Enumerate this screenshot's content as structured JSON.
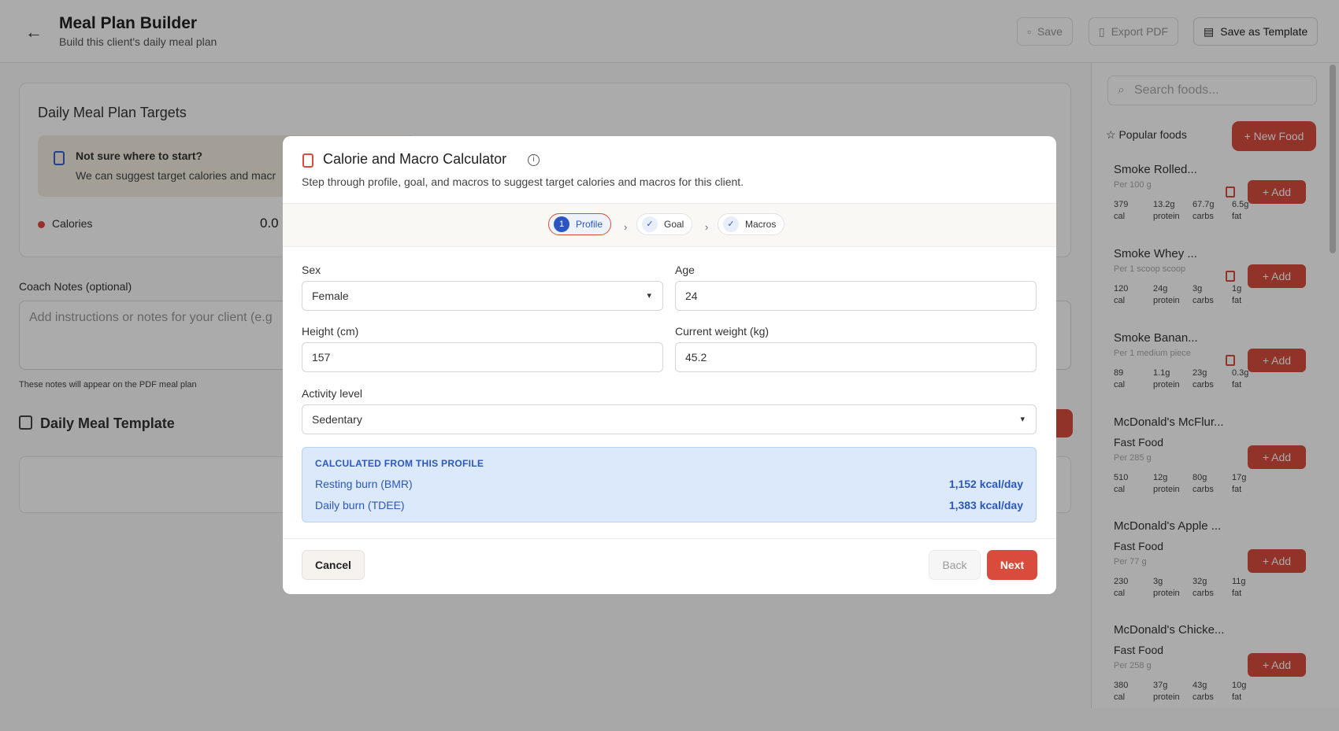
{
  "header": {
    "title": "Meal Plan Builder",
    "subtitle": "Build this client's daily meal plan",
    "save_label": "Save",
    "export_label": "Export PDF",
    "template_label": "Save as Template"
  },
  "targets": {
    "title": "Daily Meal Plan Targets",
    "tip_title": "Not sure where to start?",
    "tip_text": "We can suggest target calories and macr",
    "calories_label": "Calories",
    "calories_value": "0.0"
  },
  "notes": {
    "label": "Coach Notes (optional)",
    "placeholder": "Add instructions or notes for your client (e.g",
    "hint": "These notes will appear on the PDF meal plan"
  },
  "template": {
    "title": "Daily Meal Template"
  },
  "sidebar": {
    "search_placeholder": "Search foods...",
    "popular_label": "Popular foods",
    "new_food_label": "+ New Food",
    "add_label": "+ Add",
    "foods": [
      {
        "name": "Smoke Rolled...",
        "category": "",
        "serving": "Per 100 g",
        "cal": "379",
        "protein": "13.2g",
        "carbs": "67.7g",
        "fat": "6.5g",
        "deletable": true
      },
      {
        "name": "Smoke Whey ...",
        "category": "",
        "serving": "Per 1 scoop scoop",
        "cal": "120",
        "protein": "24g",
        "carbs": "3g",
        "fat": "1g",
        "deletable": true
      },
      {
        "name": "Smoke Banan...",
        "category": "",
        "serving": "Per 1 medium piece",
        "cal": "89",
        "protein": "1.1g",
        "carbs": "23g",
        "fat": "0.3g",
        "deletable": true
      },
      {
        "name": "McDonald's McFlur...",
        "category": "Fast Food",
        "serving": "Per 285 g",
        "cal": "510",
        "protein": "12g",
        "carbs": "80g",
        "fat": "17g",
        "deletable": false
      },
      {
        "name": "McDonald's Apple ...",
        "category": "Fast Food",
        "serving": "Per 77 g",
        "cal": "230",
        "protein": "3g",
        "carbs": "32g",
        "fat": "11g",
        "deletable": false
      },
      {
        "name": "McDonald's Chicke...",
        "category": "Fast Food",
        "serving": "Per 258 g",
        "cal": "380",
        "protein": "37g",
        "carbs": "43g",
        "fat": "10g",
        "deletable": false
      }
    ],
    "macro_units": {
      "cal": "cal",
      "protein": "protein",
      "carbs": "carbs",
      "fat": "fat"
    }
  },
  "modal": {
    "title": "Calorie and Macro Calculator",
    "subtitle": "Step through profile, goal, and macros to suggest target calories and macros for this client.",
    "steps": [
      {
        "number": "1",
        "label": "Profile"
      },
      {
        "label": "Goal"
      },
      {
        "label": "Macros"
      }
    ],
    "fields": {
      "sex_label": "Sex",
      "sex_value": "Female",
      "age_label": "Age",
      "age_value": "24",
      "height_label": "Height (cm)",
      "height_value": "157",
      "weight_label": "Current weight (kg)",
      "weight_value": "45.2",
      "activity_label": "Activity level",
      "activity_value": "Sedentary"
    },
    "calc": {
      "heading": "CALCULATED FROM THIS PROFILE",
      "bmr_label": "Resting burn (BMR)",
      "bmr_value": "1,152 kcal/day",
      "tdee_label": "Daily burn (TDEE)",
      "tdee_value": "1,383 kcal/day"
    },
    "cancel_label": "Cancel",
    "back_label": "Back",
    "next_label": "Next"
  }
}
